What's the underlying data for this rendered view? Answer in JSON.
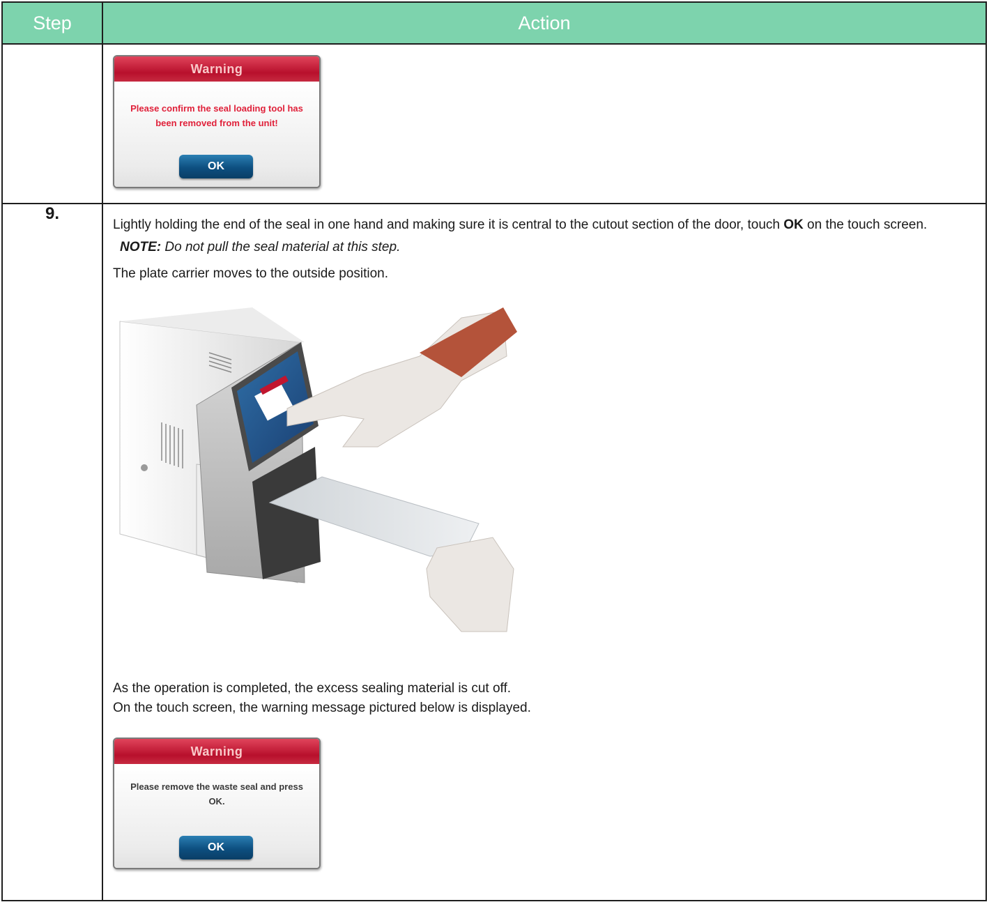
{
  "table": {
    "header": {
      "step": "Step",
      "action": "Action"
    },
    "rows": [
      {
        "step": "",
        "dialog": {
          "title": "Warning",
          "message_line1": "Please confirm the seal loading tool has",
          "message_line2": "been removed from the unit!",
          "ok_label": "OK"
        }
      },
      {
        "step": "9.",
        "instruction_before": "Lightly holding the end of the seal in one hand and making sure it is central to the cutout section of the door, touch ",
        "instruction_ok": "OK",
        "instruction_after": " on the touch screen.",
        "note_label": "NOTE:",
        "note_text": " Do not pull the seal material at this step.",
        "plate_text": "The plate carrier moves to the outside position.",
        "completed_text": "As the operation is completed, the excess sealing material is cut off.",
        "screen_text": "On the touch screen, the warning message pictured below is displayed.",
        "dialog": {
          "title": "Warning",
          "message_line1": "Please remove the waste seal and press",
          "message_line2": "OK.",
          "ok_label": "OK"
        }
      }
    ]
  },
  "colors": {
    "header_bg": "#7dd3ad",
    "dialog_red": "#c0162f",
    "ok_blue": "#0d4f80"
  }
}
